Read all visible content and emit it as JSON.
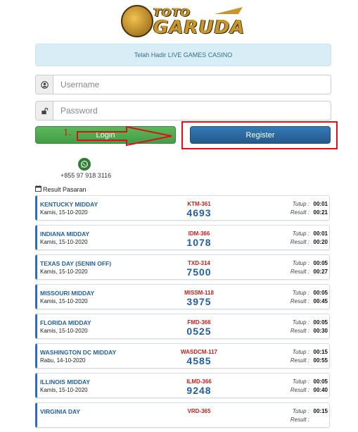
{
  "logo": {
    "line1": "TOTO",
    "line2": "GARUDA"
  },
  "notice": "Telah Hadir LIVE GAMES CASINO",
  "login_form": {
    "username_placeholder": "Username",
    "password_placeholder": "Password",
    "login_label": "Login",
    "register_label": "Register"
  },
  "annotation": {
    "step": "1."
  },
  "contact": {
    "phone": "+855 97 918 3116",
    "icon": "whatsapp-icon"
  },
  "results": {
    "header": "Result Pasaran",
    "tutup_label": "Tutup :",
    "result_label": "Result :",
    "items": [
      {
        "name": "KENTUCKY MIDDAY",
        "date": "Kamis, 15-10-2020",
        "code": "KTM-361",
        "number": "4693",
        "tutup": "00:01",
        "result": "00:21"
      },
      {
        "name": "INDIANA MIDDAY",
        "date": "Kamis, 15-10-2020",
        "code": "IDM-366",
        "number": "1078",
        "tutup": "00:01",
        "result": "00:20"
      },
      {
        "name": "TEXAS DAY (SENIN OFF)",
        "date": "Kamis, 15-10-2020",
        "code": "TXD-314",
        "number": "7500",
        "tutup": "00:05",
        "result": "00:27"
      },
      {
        "name": "MISSOURI MIDDAY",
        "date": "Kamis, 15-10-2020",
        "code": "MISSM-118",
        "number": "3975",
        "tutup": "00:05",
        "result": "00:45"
      },
      {
        "name": "FLORIDA MIDDAY",
        "date": "Kamis, 15-10-2020",
        "code": "FMD-366",
        "number": "0525",
        "tutup": "00:05",
        "result": "00:30"
      },
      {
        "name": "WASHINGTON DC MIDDAY",
        "date": "Rabu, 14-10-2020",
        "code": "WASDCM-117",
        "number": "4585",
        "tutup": "00:15",
        "result": "00:55"
      },
      {
        "name": "ILLINOIS MIDDAY",
        "date": "Kamis, 15-10-2020",
        "code": "ILMD-366",
        "number": "9248",
        "tutup": "00:05",
        "result": "00:40"
      },
      {
        "name": "VIRGINIA DAY",
        "date": "",
        "code": "VRD-365",
        "number": "",
        "tutup": "00:15",
        "result": ""
      }
    ]
  },
  "colors": {
    "login": "#5cb85c",
    "register": "#337ab7",
    "annotation": "#e0101a",
    "link_blue": "#1e5fa8",
    "code_red": "#c0221b"
  }
}
